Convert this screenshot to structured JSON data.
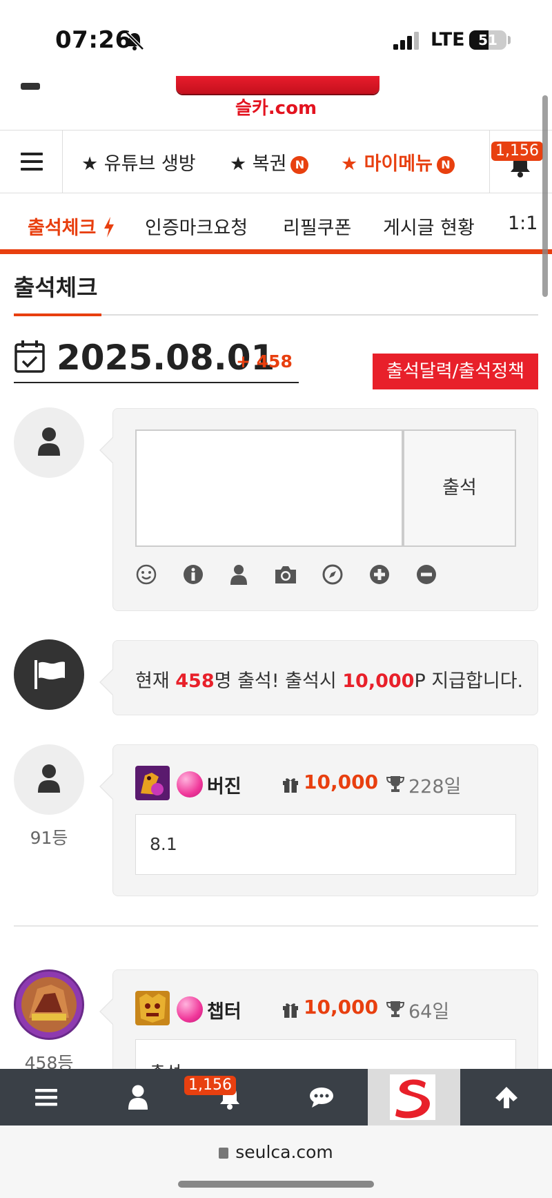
{
  "status": {
    "time": "07:26",
    "network": "LTE",
    "battery": "51",
    "battery_level": 0.51
  },
  "logo": {
    "text": "슬카.com"
  },
  "top_nav": {
    "items": [
      {
        "label": "★ 유튜브 생방",
        "badge": ""
      },
      {
        "label": "★ 복권",
        "badge": "N"
      },
      {
        "label": "★ 마이메뉴",
        "badge": "N"
      }
    ],
    "notification_count": "1,156"
  },
  "sub_nav": {
    "items": [
      "출석체크",
      "인증마크요청",
      "리필쿠폰",
      "게시글 현황",
      "1:1"
    ]
  },
  "page": {
    "title": "출석체크",
    "date": "2025.08.01",
    "date_count": "+ 458",
    "policy_button": "출석달력/출석정책"
  },
  "comment_box": {
    "attend_button": "출석",
    "tools": [
      "smile-icon",
      "info-icon",
      "user-icon",
      "camera-icon",
      "compass-icon",
      "plus-circle-icon",
      "minus-circle-icon"
    ]
  },
  "notice": {
    "prefix": "현재 ",
    "count": "458",
    "middle": "명 출석! 출석시 ",
    "points": "10,000",
    "suffix": "P 지급합니다."
  },
  "entries": [
    {
      "rank": "91등",
      "name": "버진",
      "points": "10,000",
      "days": "228일",
      "message": "8.1"
    },
    {
      "rank": "458등",
      "name": "챕터",
      "points": "10,000",
      "days": "64일",
      "message": "출석"
    }
  ],
  "bottom_bar": {
    "notification_count": "1,156",
    "items": [
      "menu-icon",
      "user-icon",
      "bell-icon",
      "chat-icon",
      "logo",
      "arrow-up-icon"
    ]
  },
  "browser": {
    "url": "seulca.com"
  },
  "colors": {
    "accent": "#e83f0f",
    "red": "#e8202a",
    "bottom_bar": "#3a4047"
  }
}
